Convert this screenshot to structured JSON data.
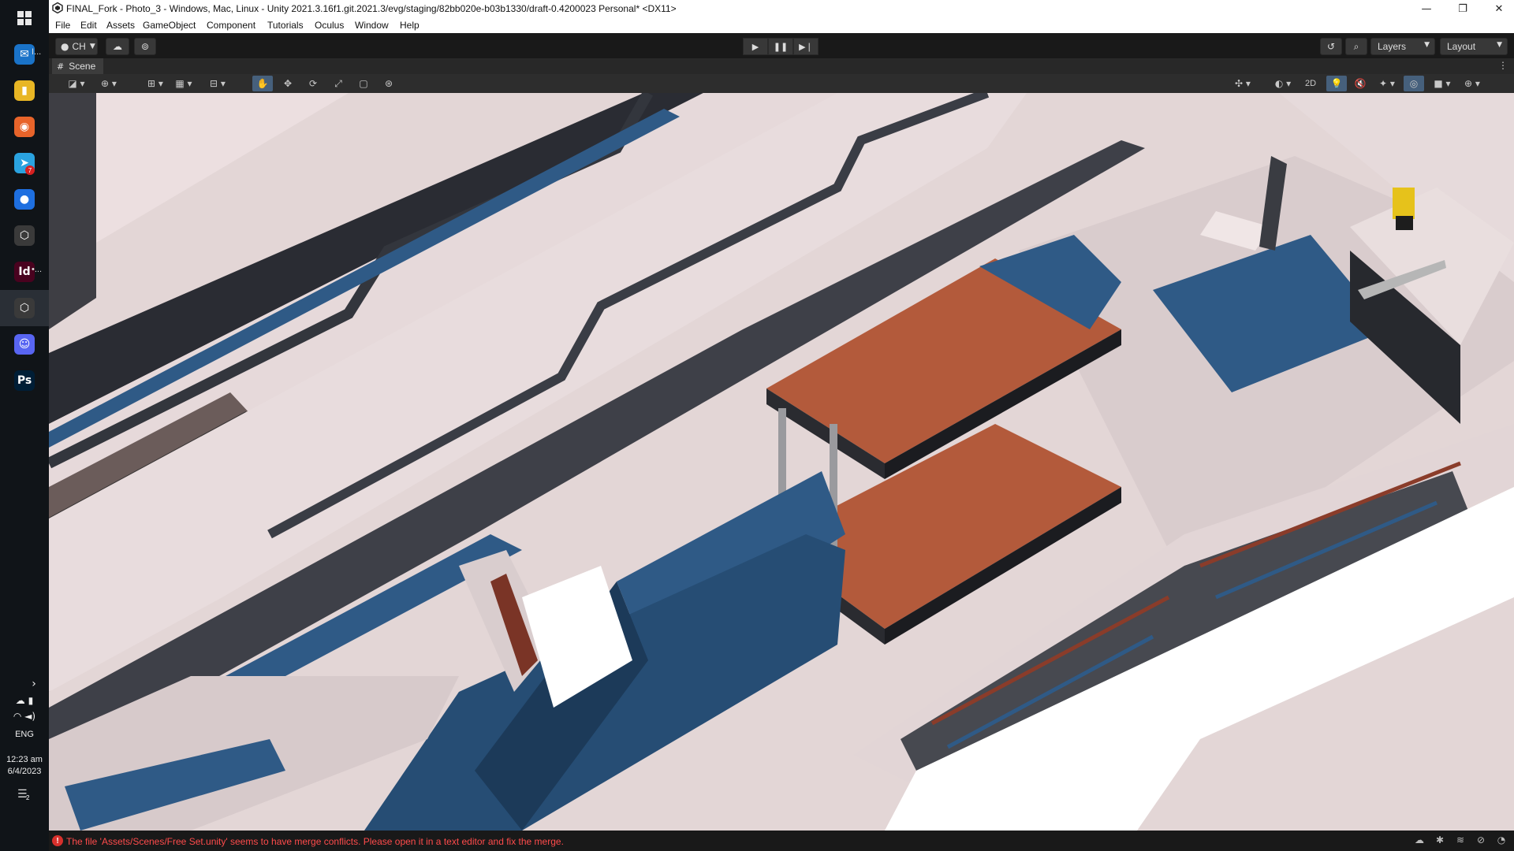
{
  "window": {
    "title": "FINAL_Fork - Photo_3 - Windows, Mac, Linux - Unity 2021.3.16f1.git.2021.3/evg/staging/82bb020e-b03b1330/draft-0.4200023 Personal* <DX11>"
  },
  "menu": [
    "File",
    "Edit",
    "Assets",
    "GameObject",
    "Component",
    "Tutorials",
    "Oculus",
    "Window",
    "Help"
  ],
  "toolbar": {
    "account_label": "CH",
    "layers_label": "Layers",
    "layout_label": "Layout"
  },
  "scene_tab": {
    "label": "Scene"
  },
  "scene_toolbar": {
    "toggle_2d": "2D"
  },
  "taskbar": {
    "apps": [
      {
        "name": "mail-icon",
        "glyph": "✉",
        "suffix": "I...",
        "color": "#1a73c8"
      },
      {
        "name": "file-explorer-icon",
        "glyph": "▮",
        "suffix": "",
        "color": "#e8b624"
      },
      {
        "name": "firefox-icon",
        "glyph": "◉",
        "suffix": "",
        "color": "#e8642a"
      },
      {
        "name": "telegram-icon",
        "glyph": "➤",
        "suffix": "",
        "color": "#2aa3e0",
        "badge": "7"
      },
      {
        "name": "maps-icon",
        "glyph": "●",
        "suffix": "",
        "color": "#1e6fe0"
      },
      {
        "name": "unity-hub-icon",
        "glyph": "⬡",
        "suffix": "",
        "color": "#3a3a3a"
      },
      {
        "name": "indesign-icon",
        "glyph": "Id",
        "suffix": "•...",
        "color": "#49021f"
      },
      {
        "name": "unity-editor-icon",
        "glyph": "⬡",
        "suffix": "",
        "color": "#3a3a3a",
        "active": true
      },
      {
        "name": "discord-icon",
        "glyph": "☺",
        "suffix": "",
        "color": "#5865f2"
      },
      {
        "name": "photoshop-icon",
        "glyph": "Ps",
        "suffix": "",
        "color": "#001e36"
      }
    ],
    "language": "ENG",
    "time": "12:23 am",
    "date": "6/4/2023",
    "notification_count": "2"
  },
  "status": {
    "error_message": "The file 'Assets/Scenes/Free Set.unity' seems to have merge conflicts. Please open it in a text editor and fix the merge.",
    "error_color": "#ff4b4b"
  }
}
